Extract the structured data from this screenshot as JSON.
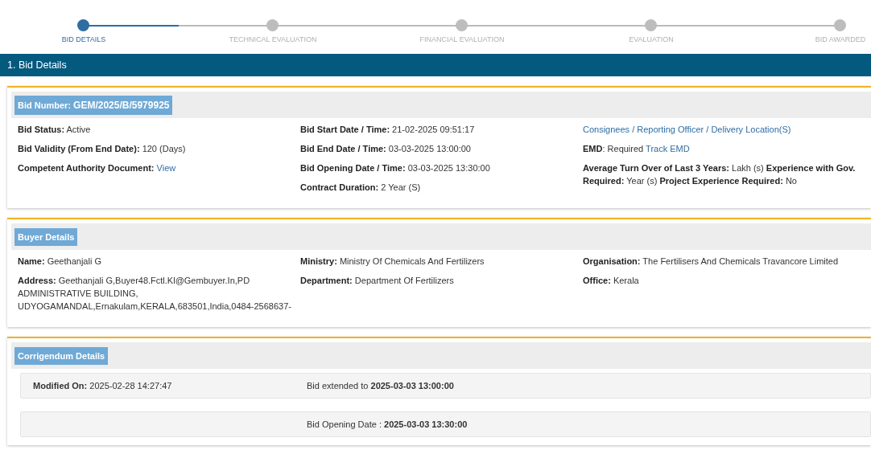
{
  "steps": [
    {
      "label": "BID DETAILS",
      "selected": true
    },
    {
      "label": "TECHNICAL EVALUATION",
      "selected": false
    },
    {
      "label": "FINANCIAL EVALUATION",
      "selected": false
    },
    {
      "label": "EVALUATION",
      "selected": false
    },
    {
      "label": "BID AWARDED",
      "selected": false
    }
  ],
  "section_title": "1. Bid Details",
  "cards": [
    {
      "kind": "grid",
      "header": "Bid Number: **GEM/2025/B/5979925**",
      "columns": [
        [
          {
            "text": "**Bid Status:** Active"
          },
          {
            "text": "**Bid Validity (From End Date):** 120 (Days)"
          },
          {
            "text": "**Competent Authority Document:**",
            "link": "View"
          }
        ],
        [
          {
            "text": "**Bid Start Date / Time:** 21-02-2025 09:51:17"
          },
          {
            "text": "**Bid End Date / Time:** 03-03-2025 13:00:00"
          },
          {
            "text": "**Bid Opening Date / Time:** 03-03-2025 13:30:00"
          },
          {
            "text": "**Contract Duration:**  2 Year (S)"
          }
        ],
        [
          {
            "link": "Consignees / Reporting Officer / Delivery Location(S)"
          },
          {
            "text": "**EMD**: Required",
            "link": "Track EMD"
          },
          {
            "text": "**Average Turn Over of Last 3 Years:** Lakh (s) **Experience with Gov. Required:** Year (s) **Project Experience Required:** No"
          }
        ]
      ]
    },
    {
      "kind": "grid",
      "header": "Buyer Details",
      "columns": [
        [
          {
            "text": "**Name:** Geethanjali G"
          },
          {
            "text": "**Address:** Geethanjali G,Buyer48.Fctl.Kl@Gembuyer.In,PD ADMINISTRATIVE BUILDING, UDYOGAMANDAL,Ernakulam,KERALA,683501,India,0484-2568637-"
          }
        ],
        [
          {
            "text": "**Ministry:** Ministry Of Chemicals And Fertilizers"
          },
          {
            "text": "**Department:** Department Of Fertilizers"
          }
        ],
        [
          {
            "text": "**Organisation:** The Fertilisers And Chemicals Travancore Limited"
          },
          {
            "text": "**Office:** Kerala"
          }
        ]
      ]
    },
    {
      "kind": "rows",
      "header": "Corrigendum Details",
      "rows": [
        {
          "left": "**Modified On:** 2025-02-28 14:27:47",
          "right": "Bid extended to **2025-03-03 13:00:00**"
        },
        {
          "right": "Bid Opening Date : **2025-03-03 13:30:00**"
        }
      ]
    }
  ]
}
